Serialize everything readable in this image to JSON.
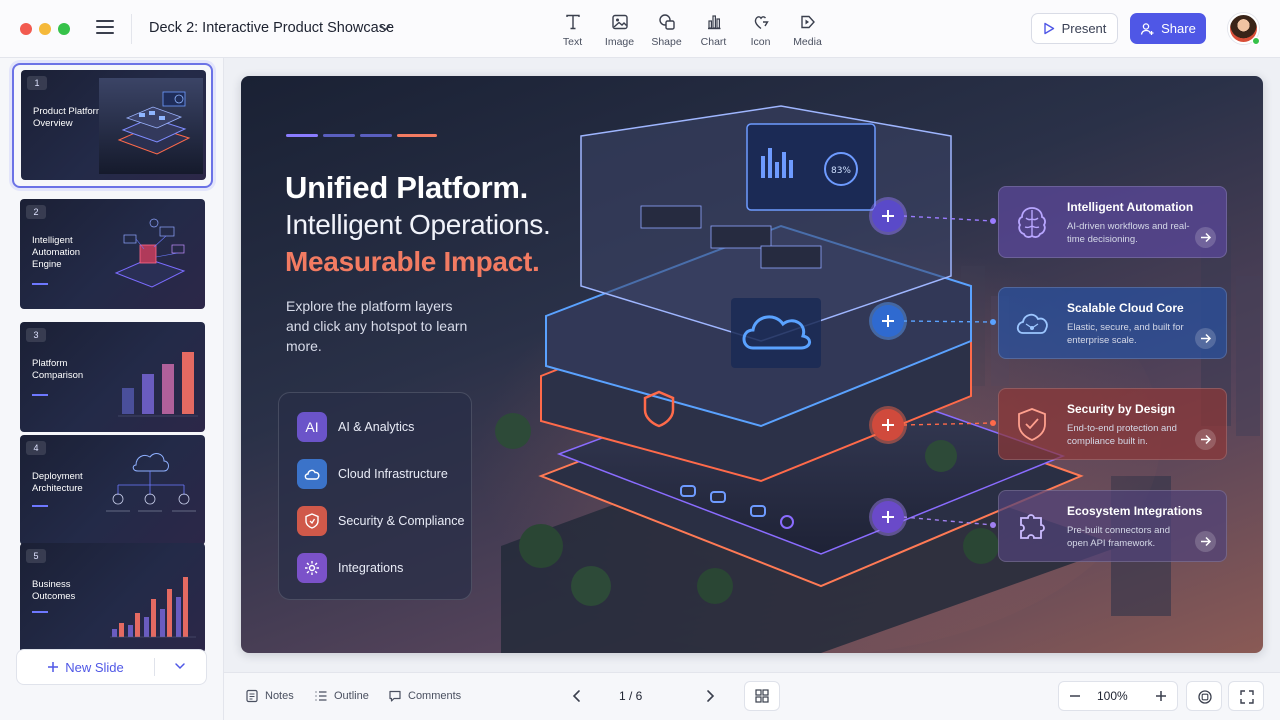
{
  "window": {
    "deck_title": "Deck 2: Interactive Product Showcase"
  },
  "toolbar": {
    "tools": [
      {
        "label": "Text",
        "icon": "text-icon"
      },
      {
        "label": "Image",
        "icon": "image-icon"
      },
      {
        "label": "Shape",
        "icon": "shape-icon"
      },
      {
        "label": "Chart",
        "icon": "chart-icon"
      },
      {
        "label": "Icon",
        "icon": "icon-icon"
      },
      {
        "label": "Media",
        "icon": "media-icon"
      }
    ],
    "present_label": "Present",
    "share_label": "Share"
  },
  "sidebar": {
    "slides": [
      {
        "number": "1",
        "title": "Product Platform Overview",
        "active": true
      },
      {
        "number": "2",
        "title": "Intelligent Automation Engine",
        "active": false
      },
      {
        "number": "3",
        "title": "Platform Comparison",
        "active": false
      },
      {
        "number": "4",
        "title": "Deployment Architecture",
        "active": false
      },
      {
        "number": "5",
        "title": "Business Outcomes",
        "active": false
      }
    ],
    "new_slide_label": "New Slide"
  },
  "slide": {
    "headline_1": "Unified Platform.",
    "headline_2": "Intelligent Operations.",
    "headline_3": "Measurable Impact.",
    "lede": "Explore the platform layers and click any hotspot to learn more.",
    "layers": [
      {
        "label": "AI & Analytics",
        "icon_text": "AI",
        "icon": "ai-icon",
        "color": "#6b54c9"
      },
      {
        "label": "Cloud Infrastructure",
        "icon": "cloud-icon",
        "color": "#3b73c9"
      },
      {
        "label": "Security & Compliance",
        "icon": "shield-icon",
        "color": "#d0594a"
      },
      {
        "label": "Integrations",
        "icon": "gear-icon",
        "color": "#7b52c9"
      }
    ],
    "callouts": [
      {
        "title": "Intelligent Automation",
        "desc": "AI-driven workflows and real-time decisioning.",
        "icon": "brain-icon",
        "color": "#8b6cf0"
      },
      {
        "title": "Scalable Cloud Core",
        "desc": "Elastic, secure, and built for enterprise scale.",
        "icon": "cloud-icon",
        "color": "#4f9bff"
      },
      {
        "title": "Security by Design",
        "desc": "End-to-end protection and compliance built in.",
        "icon": "shield-icon",
        "color": "#ff6e5a"
      },
      {
        "title": "Ecosystem Integrations",
        "desc": "Pre-built connectors and open API framework.",
        "icon": "puzzle-icon",
        "color": "#a080f0"
      }
    ],
    "screen_readout": "83%"
  },
  "bottombar": {
    "notes_label": "Notes",
    "outline_label": "Outline",
    "comments_label": "Comments",
    "page_indicator": "1 / 6",
    "zoom": "100%"
  },
  "colors": {
    "accent": "#4f57e6",
    "coral": "#f27b62",
    "slide_bg": "#1a2134"
  }
}
